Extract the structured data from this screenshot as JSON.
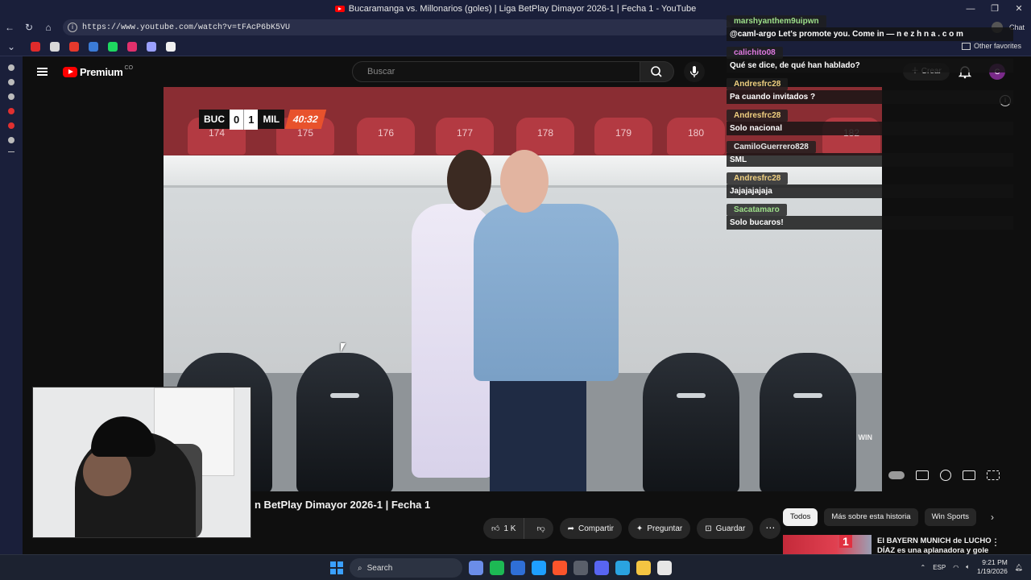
{
  "window": {
    "title": "Bucaramanga vs. Millonarios (goles) | Liga BetPlay Dimayor 2026-1 | Fecha 1 - YouTube",
    "controls": [
      "—",
      "❐",
      "✕"
    ]
  },
  "browser": {
    "url": "https://www.youtube.com/watch?v=tFAcP6bK5VU",
    "chat_label": "Chat",
    "other_favorites": "Other favorites",
    "bookmark_colors": [
      "#e02b2b",
      "#d9d9d9",
      "#e5392c",
      "#3b7bd6",
      "#1ed760",
      "#e1306c",
      "#9aa0ff",
      "#f0f0f0"
    ]
  },
  "youtube": {
    "logo_text": "Premium",
    "country": "CO",
    "search_placeholder": "Buscar",
    "create_label": "Crear",
    "channel_initial": "C"
  },
  "video": {
    "scoreboard": {
      "home": "BUC",
      "home_score": "0",
      "away_score": "1",
      "away": "MIL",
      "clock": "40:32"
    },
    "seat_numbers": [
      "174",
      "175",
      "176",
      "177",
      "178",
      "179",
      "180",
      "182"
    ],
    "watermark": "WIN"
  },
  "chat": {
    "messages": [
      {
        "user": "marshyanthem9uipwn",
        "color": "#9ee08a",
        "text": "@caml-argo Let's promote you. Come in — n e z h n a . c o m"
      },
      {
        "user": "calichito08",
        "color": "#e07ae0",
        "text": "Qué se dice, de qué han hablado?"
      },
      {
        "user": "Andresfrc28",
        "color": "#f0d080",
        "text": "Pa cuando invitados ?"
      },
      {
        "user": "Andresfrc28",
        "color": "#f0d080",
        "text": "Solo nacional"
      },
      {
        "user": "CamiloGuerrero828",
        "color": "#e6e6e6",
        "text": "SML"
      },
      {
        "user": "Andresfrc28",
        "color": "#f0d080",
        "text": "Jajajajajaja"
      },
      {
        "user": "Sacatamaro",
        "color": "#9ee08a",
        "text": "Solo bucaros!"
      }
    ]
  },
  "below": {
    "title_visible": "n BetPlay Dimayor 2026-1 | Fecha 1",
    "likes": "1 K",
    "share": "Compartir",
    "ask": "Preguntar",
    "save": "Guardar",
    "chips": [
      "Todos",
      "Más sobre esta historia",
      "Win Sports"
    ],
    "rec_title": "El BAYERN MUNICH de LUCHO DÍAZ es una aplanadora y gole",
    "rec_badge": "1"
  },
  "taskbar": {
    "search": "Search",
    "lang": "ESP",
    "time": "9:21 PM",
    "date": "1/19/2026",
    "app_colors": [
      "#6b8de8",
      "#1db954",
      "#2f6fd6",
      "#1e9fff",
      "#fb542b",
      "#5a5f6a",
      "#5865f2",
      "#2aa3e0",
      "#f4c542",
      "#e6e6e6"
    ]
  }
}
